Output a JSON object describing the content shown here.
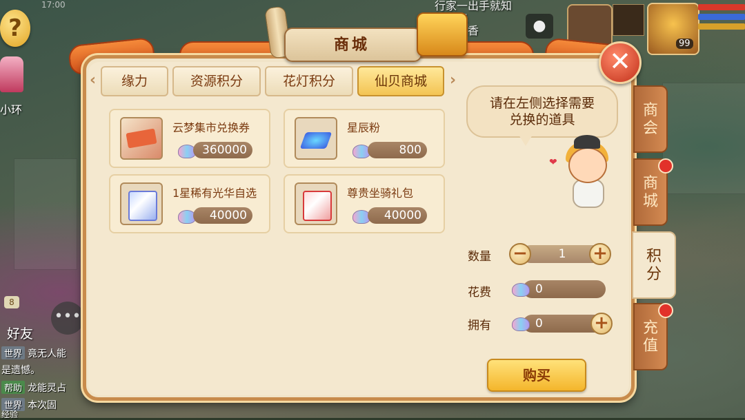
{
  "hud": {
    "status_time": "17:00",
    "npc_name": "小环",
    "quest_text": "行家一出手就知\n来来来\n看这支香",
    "player_level": "99",
    "friend_badge": "8",
    "friend_label": "好友",
    "chat": [
      {
        "channel": "世界",
        "text": "竟无人能"
      },
      {
        "channel": "",
        "text": "是遗憾。"
      },
      {
        "channel": "帮助",
        "text": "龙能灵占"
      },
      {
        "channel": "世界",
        "text": "本次固"
      },
      {
        "channel": "",
        "text": "经验"
      }
    ]
  },
  "panel": {
    "title": "商城",
    "close_label": "✕"
  },
  "tabs": [
    {
      "label": "缘力",
      "active": false
    },
    {
      "label": "资源积分",
      "active": false
    },
    {
      "label": "花灯积分",
      "active": false
    },
    {
      "label": "仙贝商城",
      "active": true
    }
  ],
  "items": [
    {
      "name": "云梦集市兑换券",
      "price": "360000",
      "icon": "ticket-icon"
    },
    {
      "name": "星辰粉",
      "price": "800",
      "icon": "star-dust-icon"
    },
    {
      "name": "1星稀有光华自选",
      "price": "40000",
      "icon": "blue-gift-icon"
    },
    {
      "name": "尊贵坐骑礼包",
      "price": "40000",
      "icon": "red-gift-icon"
    }
  ],
  "hint": "请在左侧选择需要\n兑换的道具",
  "form": {
    "quantity_label": "数量",
    "quantity_value": "1",
    "cost_label": "花费",
    "cost_value": "0",
    "owned_label": "拥有",
    "owned_value": "0",
    "minus": "−",
    "plus": "+"
  },
  "buy_label": "购买",
  "side_tabs": [
    {
      "label": "商\n会",
      "active": false,
      "dot": false
    },
    {
      "label": "商\n城",
      "active": false,
      "dot": true
    },
    {
      "label": "积\n分",
      "active": true,
      "dot": false
    },
    {
      "label": "充\n值",
      "active": false,
      "dot": true
    }
  ],
  "colors": {
    "panel_bg": "#f1e4c8",
    "tab_active": "#f3c453",
    "price_bar": "#8e6a4c",
    "buy_button": "#f4b62c",
    "close_button": "#c2301a"
  }
}
